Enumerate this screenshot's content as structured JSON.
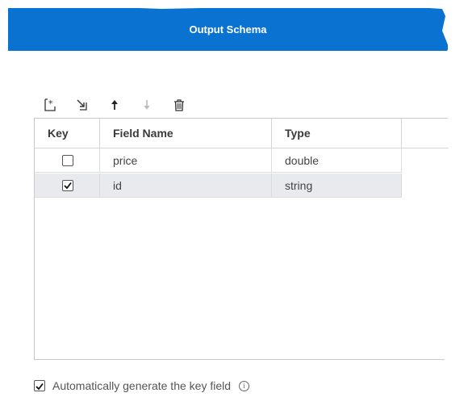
{
  "dialog": {
    "title": "Output Schema"
  },
  "toolbar": {
    "buttons": [
      {
        "icon": "add-row-icon"
      },
      {
        "icon": "insert-row-icon"
      },
      {
        "icon": "move-up-icon"
      },
      {
        "icon": "move-down-icon"
      },
      {
        "icon": "delete-icon"
      }
    ]
  },
  "table": {
    "headers": {
      "key": "Key",
      "name": "Field Name",
      "type": "Type"
    },
    "rows": [
      {
        "key_checked": false,
        "name": "price",
        "type": "double",
        "selected": false
      },
      {
        "key_checked": true,
        "name": "id",
        "type": "string",
        "selected": true
      }
    ]
  },
  "footer": {
    "autogen_label": "Automatically generate the key field",
    "autogen_checked": true
  },
  "colors": {
    "accent": "#0a73d1",
    "selected_row": "#e9eaee"
  }
}
